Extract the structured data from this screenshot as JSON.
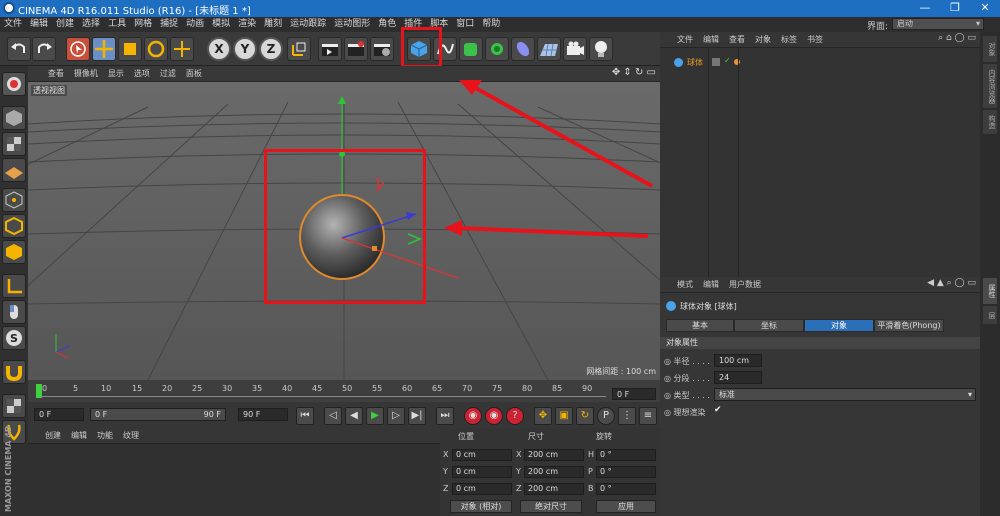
{
  "window": {
    "title": "CINEMA 4D R16.011 Studio (R16) - [未标题 1 *]",
    "min": "—",
    "restore": "❐",
    "close": "✕"
  },
  "menu": [
    "文件",
    "编辑",
    "创建",
    "选择",
    "工具",
    "网格",
    "捕捉",
    "动画",
    "模拟",
    "渲染",
    "雕刻",
    "运动跟踪",
    "运动图形",
    "角色",
    "插件",
    "脚本",
    "窗口",
    "帮助"
  ],
  "layout": {
    "label": "界面:",
    "value": "启动"
  },
  "toolbar": {
    "axis_x": "X",
    "axis_y": "Y",
    "axis_z": "Z"
  },
  "viewport": {
    "menu": [
      "查看",
      "摄像机",
      "显示",
      "选项",
      "过滤",
      "面板"
    ],
    "label": "透视视图",
    "grid_spacing": "网格间距 : 100 cm"
  },
  "timeline": {
    "ticks": [
      "0",
      "5",
      "10",
      "15",
      "20",
      "25",
      "30",
      "35",
      "40",
      "45",
      "50",
      "55",
      "60",
      "65",
      "70",
      "75",
      "80",
      "85",
      "90"
    ],
    "current": "0 F"
  },
  "transport": {
    "start": "0 F",
    "range_start": "0 F",
    "range_end": "90 F",
    "end": "90 F"
  },
  "material": {
    "menu": [
      "创建",
      "编辑",
      "功能",
      "纹理"
    ]
  },
  "coords": {
    "headers": [
      "位置",
      "尺寸",
      "旋转"
    ],
    "axis": [
      "X",
      "Y",
      "Z"
    ],
    "rot_axis": [
      "H",
      "P",
      "B"
    ],
    "pos": [
      "0 cm",
      "0 cm",
      "0 cm"
    ],
    "size": [
      "200 cm",
      "200 cm",
      "200 cm"
    ],
    "rot": [
      "0 °",
      "0 °",
      "0 °"
    ],
    "mode": "对象 (相对)",
    "size_mode": "绝对尺寸",
    "apply": "应用"
  },
  "objects": {
    "menu": [
      "文件",
      "编辑",
      "查看",
      "对象",
      "标签",
      "书签"
    ],
    "items": [
      {
        "name": "球体"
      }
    ]
  },
  "attributes": {
    "menu": [
      "模式",
      "编辑",
      "用户数据"
    ],
    "title": "球体对象 [球体]",
    "tabs": [
      "基本",
      "坐标",
      "对象",
      "平滑着色(Phong)"
    ],
    "active_tab": 2,
    "section": "对象属性",
    "props": [
      {
        "label": "半径 . . . .",
        "value": "100 cm"
      },
      {
        "label": "分段 . . . .",
        "value": "24"
      },
      {
        "label": "类型 . . . .",
        "value": "标准"
      },
      {
        "label": "理想渲染",
        "value": "✔"
      }
    ]
  },
  "side_tabs": [
    "对象",
    "内容浏览器",
    "构造",
    "属性",
    "层"
  ],
  "brand": {
    "line1": "MAXON",
    "line2": "CINEMA 4D"
  },
  "colors": {
    "accent": "#1e6fc2",
    "highlight": "#e8121a",
    "active_tab": "#2b6fb8"
  }
}
